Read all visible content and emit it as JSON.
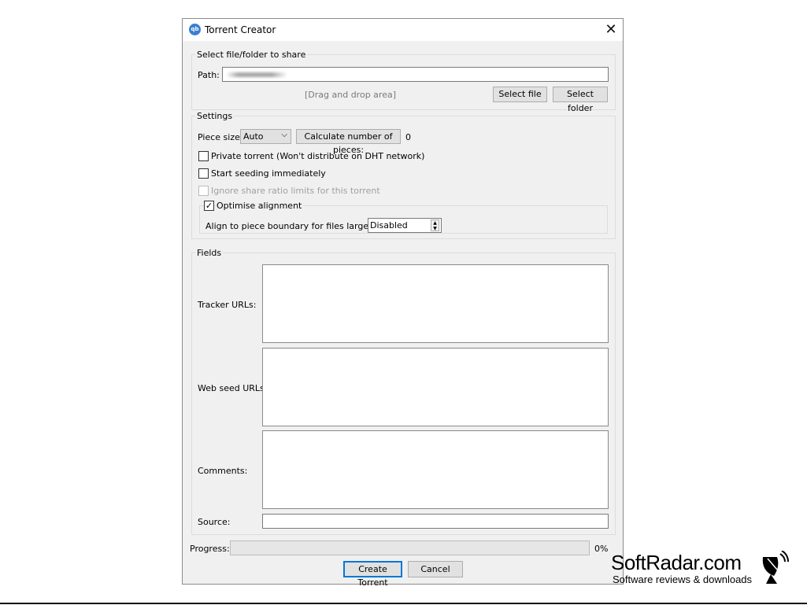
{
  "window": {
    "title": "Torrent Creator",
    "icon_text": "qb",
    "close_glyph": "✕"
  },
  "file_section": {
    "title": "Select file/folder to share",
    "path_label": "Path:",
    "path_value": "",
    "drop_area": "[Drag and drop area]",
    "select_file": "Select file",
    "select_folder": "Select folder"
  },
  "settings": {
    "title": "Settings",
    "piece_size_label": "Piece size:",
    "piece_size_value": "Auto",
    "calculate_button": "Calculate number of pieces:",
    "pieces_count": "0",
    "private_torrent": {
      "label": "Private torrent (Won't distribute on DHT network)",
      "checked": false
    },
    "start_seeding": {
      "label": "Start seeding immediately",
      "checked": false
    },
    "ignore_ratio": {
      "label": "Ignore share ratio limits for this torrent",
      "checked": false,
      "disabled": true
    },
    "optimise": {
      "label": "Optimise alignment",
      "checked": true
    },
    "align_label": "Align to piece boundary for files larger than:",
    "align_value": "Disabled"
  },
  "fields": {
    "title": "Fields",
    "tracker_urls": "Tracker URLs:",
    "web_seed_urls": "Web seed URLs:",
    "comments": "Comments:",
    "source": "Source:"
  },
  "footer": {
    "progress_label": "Progress:",
    "progress_value": "0%",
    "progress_fraction": 0,
    "create_button": "Create Torrent",
    "cancel_button": "Cancel"
  },
  "watermark": {
    "brand": "SoftRadar.com",
    "tagline": "Software reviews & downloads"
  }
}
